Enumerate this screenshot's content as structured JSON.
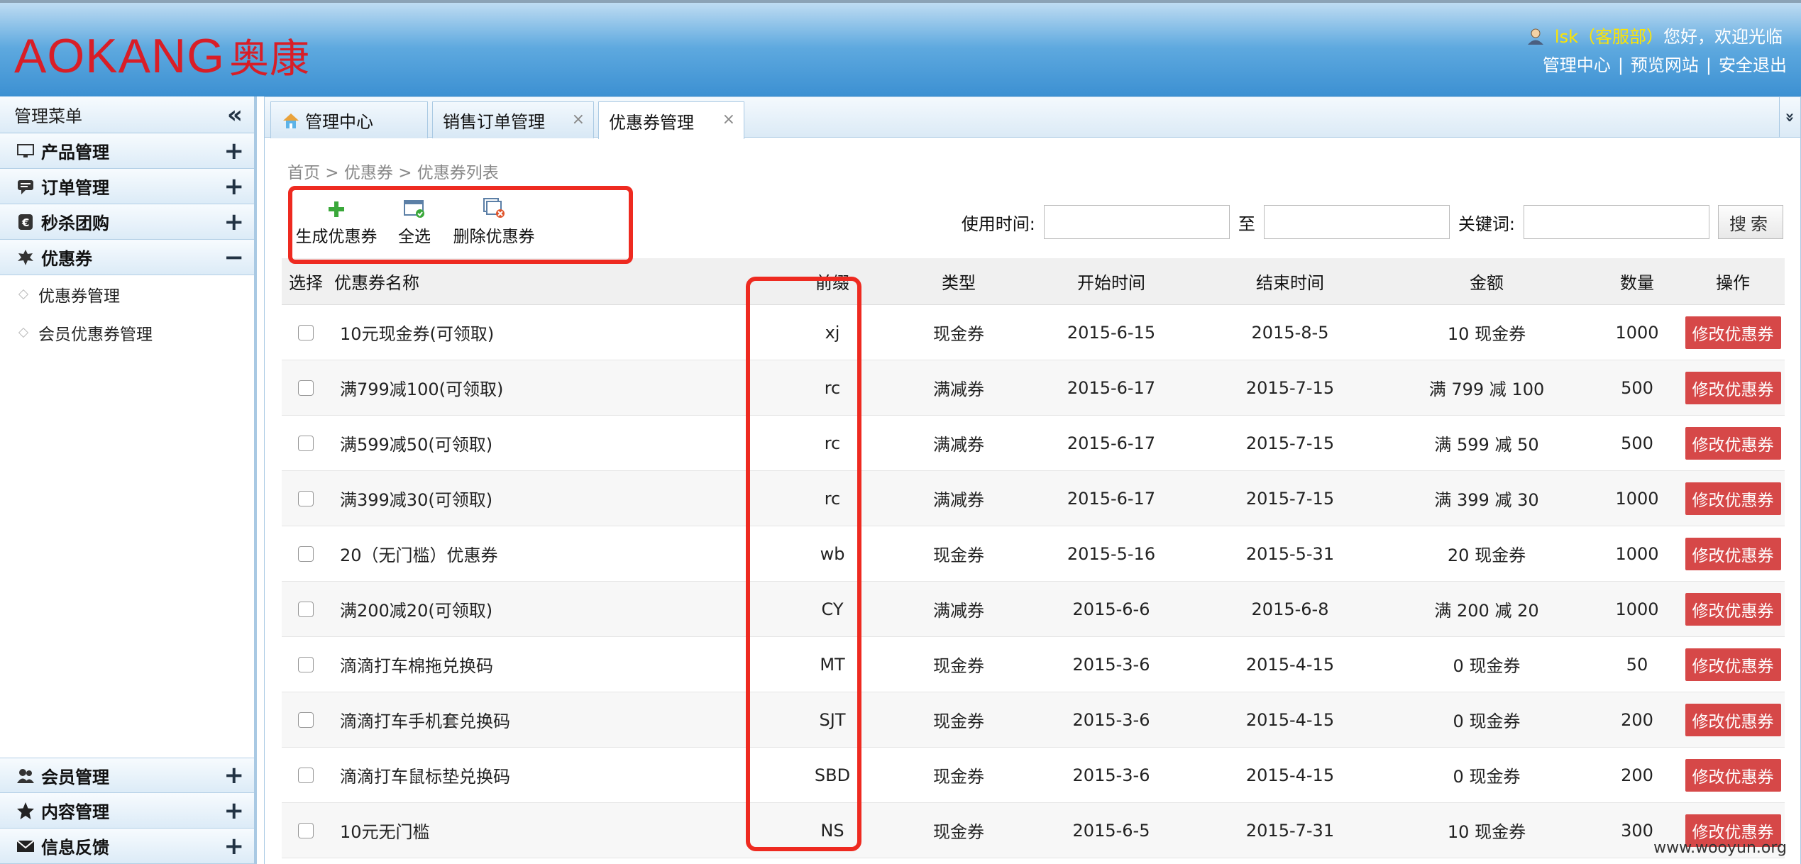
{
  "header": {
    "logo_text": "AOKANG",
    "logo_cn": "奥康",
    "user_name": "lsk（客服部）",
    "greeting": "您好，欢迎光临",
    "links": [
      "管理中心",
      "预览网站",
      "安全退出"
    ],
    "link_sep": "|"
  },
  "sidebar": {
    "title": "管理菜单",
    "collapse_icon": "«",
    "groups_top": [
      {
        "label": "产品管理",
        "icon": "monitor-icon",
        "state": "+"
      },
      {
        "label": "订单管理",
        "icon": "chat-icon",
        "state": "+"
      },
      {
        "label": "秒杀团购",
        "icon": "flash-icon",
        "state": "+"
      },
      {
        "label": "优惠券",
        "icon": "leaf-icon",
        "state": "−"
      }
    ],
    "sub_items": [
      "优惠券管理",
      "会员优惠券管理"
    ],
    "groups_bottom": [
      {
        "label": "会员管理",
        "icon": "users-icon",
        "state": "+"
      },
      {
        "label": "内容管理",
        "icon": "star-icon",
        "state": "+"
      },
      {
        "label": "信息反馈",
        "icon": "mail-icon",
        "state": "+"
      }
    ]
  },
  "tabs": [
    {
      "label": "管理中心",
      "closable": false
    },
    {
      "label": "销售订单管理",
      "closable": true
    },
    {
      "label": "优惠券管理",
      "closable": true,
      "active": true
    }
  ],
  "tab_close": "×",
  "tab_more": "»",
  "breadcrumb": "首页 > 优惠券 > 优惠券列表",
  "toolbar": {
    "create_label": "生成优惠券",
    "select_all_label": "全选",
    "delete_label": "删除优惠券"
  },
  "search": {
    "use_time_label": "使用时间:",
    "to_label": "至",
    "keyword_label": "关键词:",
    "button_label": "搜索"
  },
  "table": {
    "columns": [
      "选择",
      "优惠券名称",
      "前缀",
      "类型",
      "开始时间",
      "结束时间",
      "金额",
      "数量",
      "操作"
    ],
    "action_label": "修改优惠券",
    "rows": [
      {
        "name": "10元现金券(可领取)",
        "prefix": "xj",
        "type": "现金券",
        "start": "2015-6-15",
        "end": "2015-8-5",
        "amount": "10 现金券",
        "qty": "1000"
      },
      {
        "name": "满799减100(可领取)",
        "prefix": "rc",
        "type": "满减券",
        "start": "2015-6-17",
        "end": "2015-7-15",
        "amount": "满 799 减 100",
        "qty": "500"
      },
      {
        "name": "满599减50(可领取)",
        "prefix": "rc",
        "type": "满减券",
        "start": "2015-6-17",
        "end": "2015-7-15",
        "amount": "满 599 减 50",
        "qty": "500"
      },
      {
        "name": "满399减30(可领取)",
        "prefix": "rc",
        "type": "满减券",
        "start": "2015-6-17",
        "end": "2015-7-15",
        "amount": "满 399 减 30",
        "qty": "1000"
      },
      {
        "name": "20（无门槛）优惠券",
        "prefix": "wb",
        "type": "现金券",
        "start": "2015-5-16",
        "end": "2015-5-31",
        "amount": "20 现金券",
        "qty": "1000"
      },
      {
        "name": "满200减20(可领取)",
        "prefix": "CY",
        "type": "满减券",
        "start": "2015-6-6",
        "end": "2015-6-8",
        "amount": "满 200 减 20",
        "qty": "1000"
      },
      {
        "name": "滴滴打车棉拖兑换码",
        "prefix": "MT",
        "type": "现金券",
        "start": "2015-3-6",
        "end": "2015-4-15",
        "amount": "0 现金券",
        "qty": "50"
      },
      {
        "name": "滴滴打车手机套兑换码",
        "prefix": "SJT",
        "type": "现金券",
        "start": "2015-3-6",
        "end": "2015-4-15",
        "amount": "0 现金券",
        "qty": "200"
      },
      {
        "name": "滴滴打车鼠标垫兑换码",
        "prefix": "SBD",
        "type": "现金券",
        "start": "2015-3-6",
        "end": "2015-4-15",
        "amount": "0 现金券",
        "qty": "200"
      },
      {
        "name": "10元无门槛",
        "prefix": "NS",
        "type": "现金券",
        "start": "2015-6-5",
        "end": "2015-7-31",
        "amount": "10 现金券",
        "qty": "300"
      }
    ]
  },
  "watermark": "www.wooyun.org",
  "colors": {
    "accent_red": "#d81e27",
    "highlight_box": "#ee2a20",
    "edit_button": "#d64848",
    "header_blue": "#3c90d2",
    "username_yellow": "#ffe500"
  }
}
